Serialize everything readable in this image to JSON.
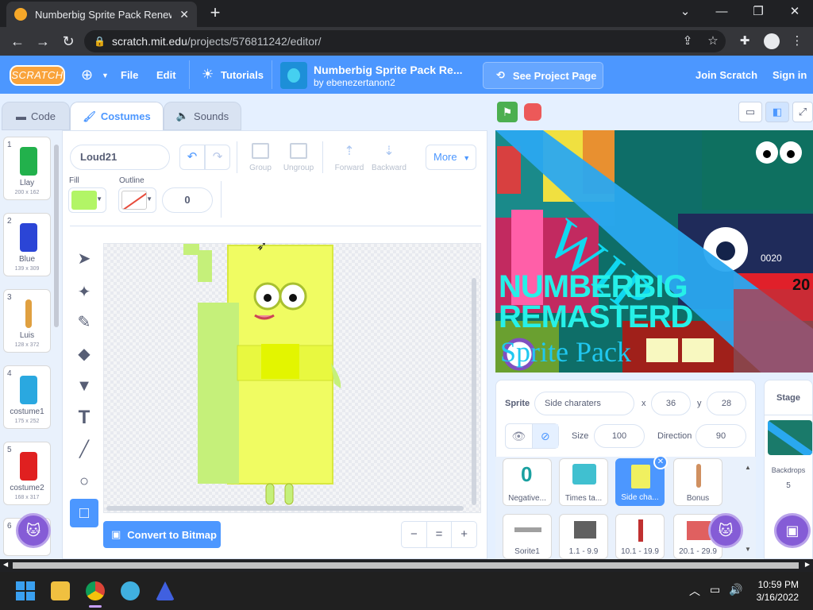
{
  "browser": {
    "tab_title": "Numberbig Sprite Pack Renewen",
    "tab_close": "✕",
    "new_tab": "+",
    "url_host": "scratch.mit.edu",
    "url_path": "/projects/576811242/editor/"
  },
  "menubar": {
    "logo": "SCRATCH",
    "file": "File",
    "edit": "Edit",
    "tutorials": "Tutorials",
    "project_title": "Numberbig Sprite Pack Re...",
    "project_author": "by ebenezertanon2",
    "see_project_page": "See Project Page",
    "join": "Join Scratch",
    "sign_in": "Sign in"
  },
  "editor_tabs": {
    "code": "Code",
    "costumes": "Costumes",
    "sounds": "Sounds"
  },
  "costumes": [
    {
      "num": "1",
      "name": "Llay",
      "size": "200 x 162",
      "color": "#22b14c"
    },
    {
      "num": "2",
      "name": "Blue",
      "size": "139 x 309",
      "color": "#2b45d6"
    },
    {
      "num": "3",
      "name": "Luis",
      "size": "128 x 372",
      "color": "#e0a040"
    },
    {
      "num": "4",
      "name": "costume1",
      "size": "175 x 252",
      "color": "#2aa8e0"
    },
    {
      "num": "5",
      "name": "costume2",
      "size": "168 x 317",
      "color": "#e02020"
    },
    {
      "num": "6",
      "name": "",
      "size": "",
      "color": "#ffffff"
    }
  ],
  "paint": {
    "costume_name": "Loud21",
    "group": "Group",
    "ungroup": "Ungroup",
    "forward": "Forward",
    "backward": "Backward",
    "more": "More",
    "fill_label": "Fill",
    "outline_label": "Outline",
    "outline_width": "0",
    "fill_color": "#b2f566",
    "convert": "Convert to Bitmap",
    "zoom_out": "−",
    "zoom_reset": "=",
    "zoom_in": "+"
  },
  "sprite_info": {
    "sprite_label": "Sprite",
    "sprite_name": "Side charaters",
    "x_label": "x",
    "x": "36",
    "y_label": "y",
    "y": "28",
    "size_label": "Size",
    "size": "100",
    "direction_label": "Direction",
    "direction": "90"
  },
  "sprites": [
    {
      "name": "Negative...",
      "color": "#1aa0a0"
    },
    {
      "name": "Times ta...",
      "color": "#40c0d0"
    },
    {
      "name": "Side cha...",
      "color": "#f0f060",
      "selected": true
    },
    {
      "name": "Bonus",
      "color": "#d09060"
    },
    {
      "name": "Sorite1",
      "color": "#a0a0a0"
    },
    {
      "name": "1.1 - 9.9",
      "color": "#606060"
    },
    {
      "name": "10.1 - 19.9",
      "color": "#c03030"
    },
    {
      "name": "20.1 - 29.9",
      "color": "#e06060"
    }
  ],
  "stage_pane": {
    "title": "Stage",
    "backdrops_label": "Backdrops",
    "backdrops_count": "5"
  },
  "stage_art": {
    "banner": "WIP",
    "line1": "NUMBERBIG",
    "line2": "REMASTERD",
    "line3": "Sprite Pack",
    "small1": "0020",
    "small2": "20"
  },
  "taskbar": {
    "time": "10:59 PM",
    "date": "3/16/2022"
  },
  "colors": {
    "scratch_blue": "#4c97ff",
    "scratch_purple": "#855cd6"
  }
}
